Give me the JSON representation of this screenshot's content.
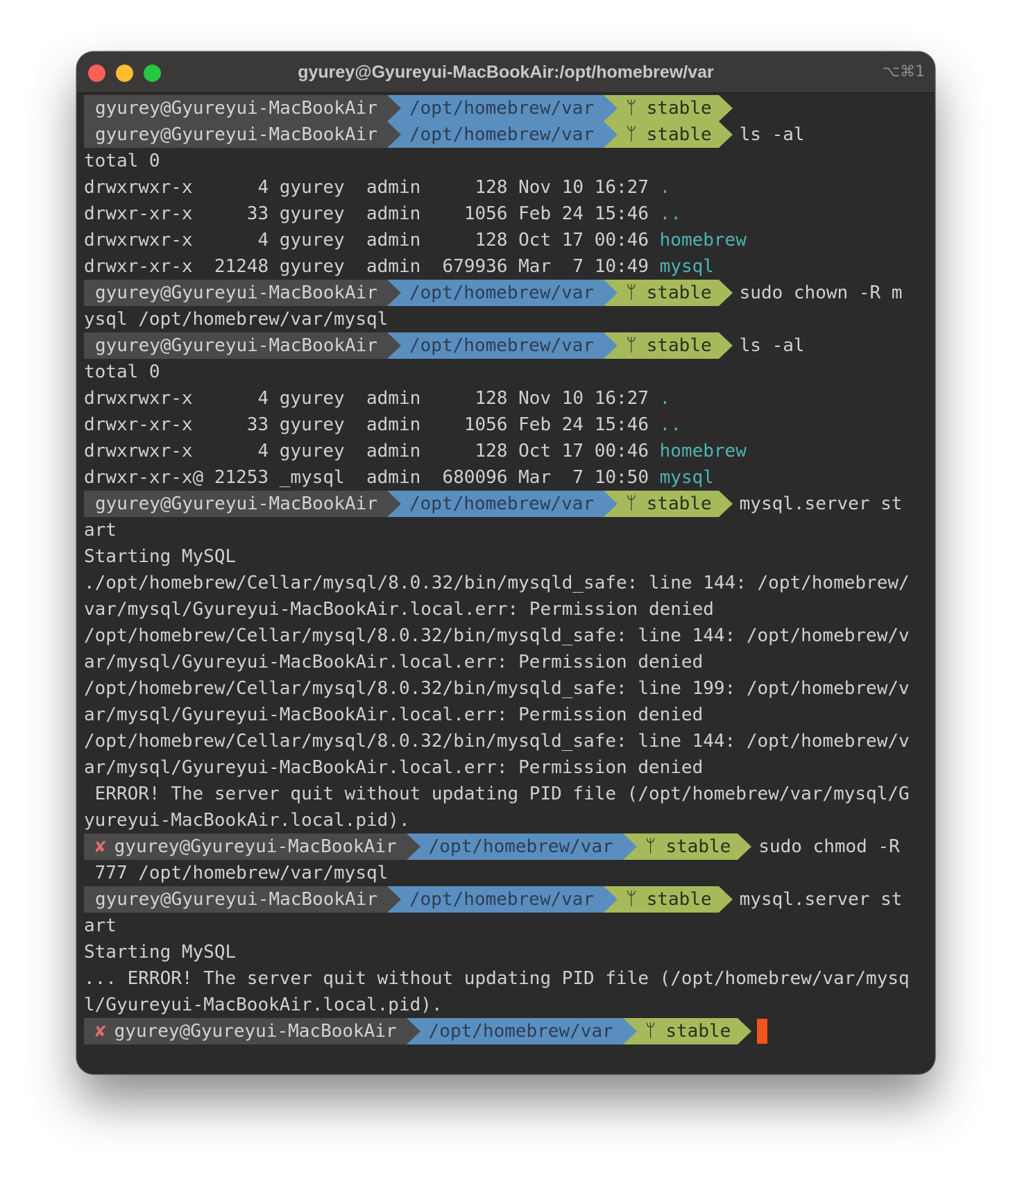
{
  "window": {
    "title": "gyurey@Gyureyui-MacBookAir:/opt/homebrew/var",
    "shortcut": "⌥⌘1"
  },
  "prompt": {
    "user": "gyurey@Gyureyui-MacBookAir",
    "path": "/opt/homebrew/var",
    "branch_icon": "git-branch-icon",
    "branch_glyph": "ᛘ",
    "branch": "stable",
    "error_mark": "✘"
  },
  "colors": {
    "user_segment": "#4a4a4a",
    "path_segment": "#5a8ebf",
    "branch_segment": "#a6ba5c",
    "directory": "#4fb3b3",
    "error": "#e06c75",
    "cursor": "#f0561d"
  },
  "lines": [
    {
      "type": "prompt",
      "cmd": ""
    },
    {
      "type": "prompt",
      "cmd": "ls -al"
    },
    {
      "type": "text",
      "text": "total 0"
    },
    {
      "type": "ls",
      "text": "drwxrwxr-x      4 gyurey  admin     128 Nov 10 16:27 ",
      "name": "."
    },
    {
      "type": "ls",
      "text": "drwxr-xr-x     33 gyurey  admin    1056 Feb 24 15:46 ",
      "name": ".."
    },
    {
      "type": "ls",
      "text": "drwxrwxr-x      4 gyurey  admin     128 Oct 17 00:46 ",
      "name": "homebrew"
    },
    {
      "type": "ls",
      "text": "drwxr-xr-x  21248 gyurey  admin  679936 Mar  7 10:49 ",
      "name": "mysql"
    },
    {
      "type": "prompt",
      "cmd": "sudo chown -R m"
    },
    {
      "type": "text",
      "text": "ysql /opt/homebrew/var/mysql"
    },
    {
      "type": "prompt",
      "cmd": "ls -al"
    },
    {
      "type": "text",
      "text": "total 0"
    },
    {
      "type": "ls",
      "text": "drwxrwxr-x      4 gyurey  admin     128 Nov 10 16:27 ",
      "name": "."
    },
    {
      "type": "ls",
      "text": "drwxr-xr-x     33 gyurey  admin    1056 Feb 24 15:46 ",
      "name": ".."
    },
    {
      "type": "ls",
      "text": "drwxrwxr-x      4 gyurey  admin     128 Oct 17 00:46 ",
      "name": "homebrew"
    },
    {
      "type": "ls",
      "text": "drwxr-xr-x@ 21253 _mysql  admin  680096 Mar  7 10:50 ",
      "name": "mysql"
    },
    {
      "type": "prompt",
      "cmd": "mysql.server st"
    },
    {
      "type": "text",
      "text": "art"
    },
    {
      "type": "text",
      "text": "Starting MySQL"
    },
    {
      "type": "text",
      "text": "./opt/homebrew/Cellar/mysql/8.0.32/bin/mysqld_safe: line 144: /opt/homebrew/"
    },
    {
      "type": "text",
      "text": "var/mysql/Gyureyui-MacBookAir.local.err: Permission denied"
    },
    {
      "type": "text",
      "text": "/opt/homebrew/Cellar/mysql/8.0.32/bin/mysqld_safe: line 144: /opt/homebrew/v"
    },
    {
      "type": "text",
      "text": "ar/mysql/Gyureyui-MacBookAir.local.err: Permission denied"
    },
    {
      "type": "text",
      "text": "/opt/homebrew/Cellar/mysql/8.0.32/bin/mysqld_safe: line 199: /opt/homebrew/v"
    },
    {
      "type": "text",
      "text": "ar/mysql/Gyureyui-MacBookAir.local.err: Permission denied"
    },
    {
      "type": "text",
      "text": "/opt/homebrew/Cellar/mysql/8.0.32/bin/mysqld_safe: line 144: /opt/homebrew/v"
    },
    {
      "type": "text",
      "text": "ar/mysql/Gyureyui-MacBookAir.local.err: Permission denied"
    },
    {
      "type": "text",
      "text": " ERROR! The server quit without updating PID file (/opt/homebrew/var/mysql/G"
    },
    {
      "type": "text",
      "text": "yureyui-MacBookAir.local.pid)."
    },
    {
      "type": "prompt",
      "error": true,
      "cmd": "sudo chmod -R"
    },
    {
      "type": "text",
      "text": " 777 /opt/homebrew/var/mysql"
    },
    {
      "type": "prompt",
      "cmd": "mysql.server st"
    },
    {
      "type": "text",
      "text": "art"
    },
    {
      "type": "text",
      "text": "Starting MySQL"
    },
    {
      "type": "text",
      "text": "... ERROR! The server quit without updating PID file (/opt/homebrew/var/mysq"
    },
    {
      "type": "text",
      "text": "l/Gyureyui-MacBookAir.local.pid)."
    },
    {
      "type": "prompt",
      "error": true,
      "cmd": "",
      "cursor": true
    }
  ]
}
